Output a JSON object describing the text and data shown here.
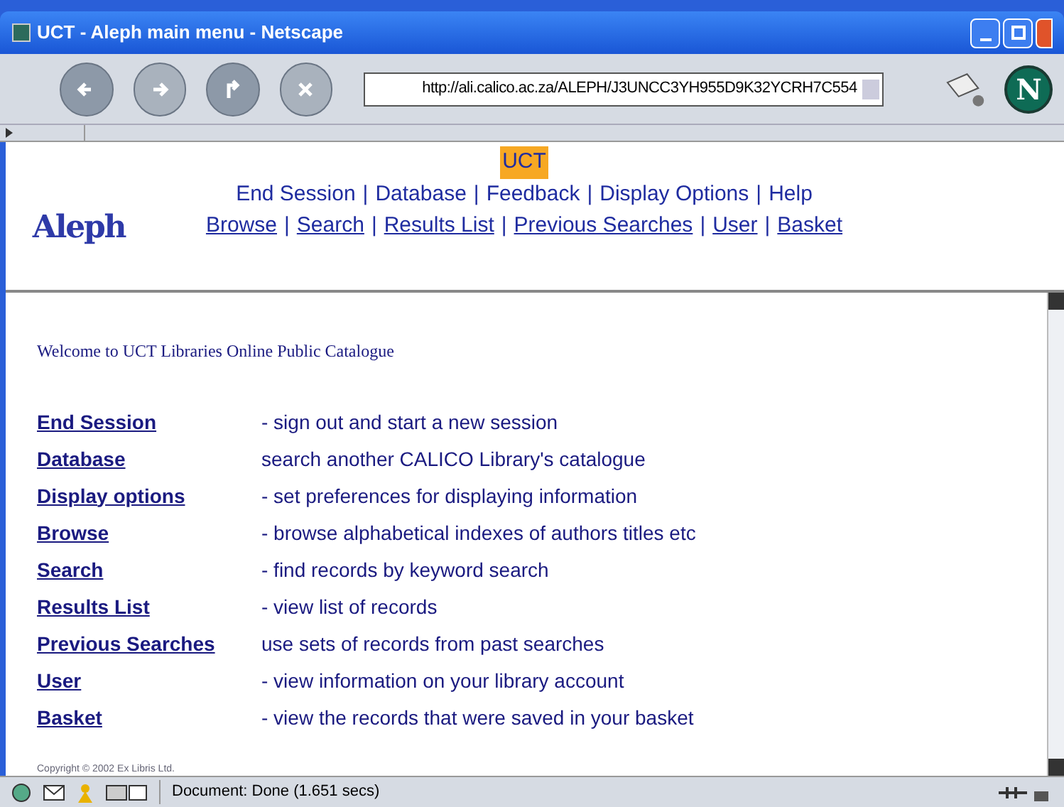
{
  "window": {
    "title": "UCT - Aleph main menu - Netscape"
  },
  "toolbar": {
    "url": "http://ali.calico.ac.za/ALEPH/J3UNCC3YH955D9K32YCRH7C554",
    "logo_letter": "N"
  },
  "header": {
    "logo_text": "Aleph",
    "site_label": "UCT",
    "nav_rows": [
      [
        {
          "kind": "link",
          "text": "End Session"
        },
        {
          "kind": "sep",
          "text": "|"
        },
        {
          "kind": "link",
          "text": "Database"
        },
        {
          "kind": "sep",
          "text": "|"
        },
        {
          "kind": "link",
          "text": "Feedback"
        },
        {
          "kind": "sep",
          "text": "|"
        },
        {
          "kind": "link",
          "text": "Display Options"
        },
        {
          "kind": "sep",
          "text": "|"
        },
        {
          "kind": "link",
          "text": "Help"
        }
      ],
      [
        {
          "kind": "ulink",
          "text": "Browse"
        },
        {
          "kind": "sep",
          "text": "|"
        },
        {
          "kind": "ulink",
          "text": "Search"
        },
        {
          "kind": "sep",
          "text": "|"
        },
        {
          "kind": "ulink",
          "text": "Results List"
        },
        {
          "kind": "sep",
          "text": "|"
        },
        {
          "kind": "ulink",
          "text": "Previous Searches"
        },
        {
          "kind": "sep",
          "text": "|"
        },
        {
          "kind": "ulink",
          "text": "User"
        },
        {
          "kind": "sep",
          "text": "|"
        },
        {
          "kind": "ulink",
          "text": "Basket"
        }
      ]
    ]
  },
  "welcome": "Welcome to UCT Libraries Online Public Catalogue",
  "menu": [
    {
      "link": "End Session",
      "description": "- sign out and start a new session"
    },
    {
      "link": "Database",
      "description": "search another CALICO Library's catalogue"
    },
    {
      "link": "Display options",
      "description": "- set preferences for displaying information"
    },
    {
      "link": "Browse",
      "description": "- browse alphabetical indexes of authors titles etc"
    },
    {
      "link": "Search",
      "description": "- find records by keyword search"
    },
    {
      "link": "Results List",
      "description": "- view list of records"
    },
    {
      "link": "Previous Searches",
      "description": "use sets of records from past searches"
    },
    {
      "link": "User",
      "description": "- view information on your library account"
    },
    {
      "link": "Basket",
      "description": "- view the records that were saved in your basket"
    }
  ],
  "footer_note": "Copyright © 2002 Ex Libris Ltd.",
  "status_bar": {
    "text": "Document: Done (1.651 secs)"
  }
}
